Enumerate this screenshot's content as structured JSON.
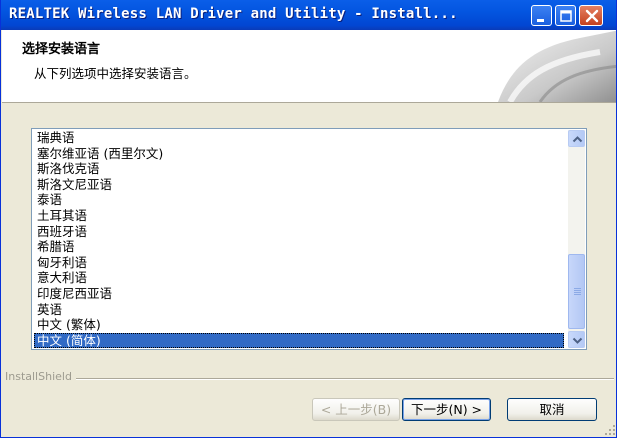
{
  "window": {
    "title": "REALTEK Wireless LAN Driver and Utility - Install...",
    "controls": [
      "minimize-icon",
      "maximize-icon",
      "close-icon"
    ]
  },
  "header": {
    "title": "选择安装语言",
    "subtitle": "从下列选项中选择安装语言。"
  },
  "language_list": {
    "items": [
      "瑞典语",
      "塞尔维亚语 (西里尔文)",
      "斯洛伐克语",
      "斯洛文尼亚语",
      "泰语",
      "土耳其语",
      "西班牙语",
      "希腊语",
      "匈牙利语",
      "意大利语",
      "印度尼西亚语",
      "英语",
      "中文 (繁体)",
      "中文 (简体)"
    ],
    "selected_index": 13
  },
  "footer": {
    "brand": "InstallShield",
    "back_label": "< 上一步(B)",
    "next_label": "下一步(N) >",
    "cancel_label": "取消"
  },
  "colors": {
    "titlebar": "#0355e0",
    "selection": "#316ac5",
    "dialog_bg": "#ece9d8"
  }
}
